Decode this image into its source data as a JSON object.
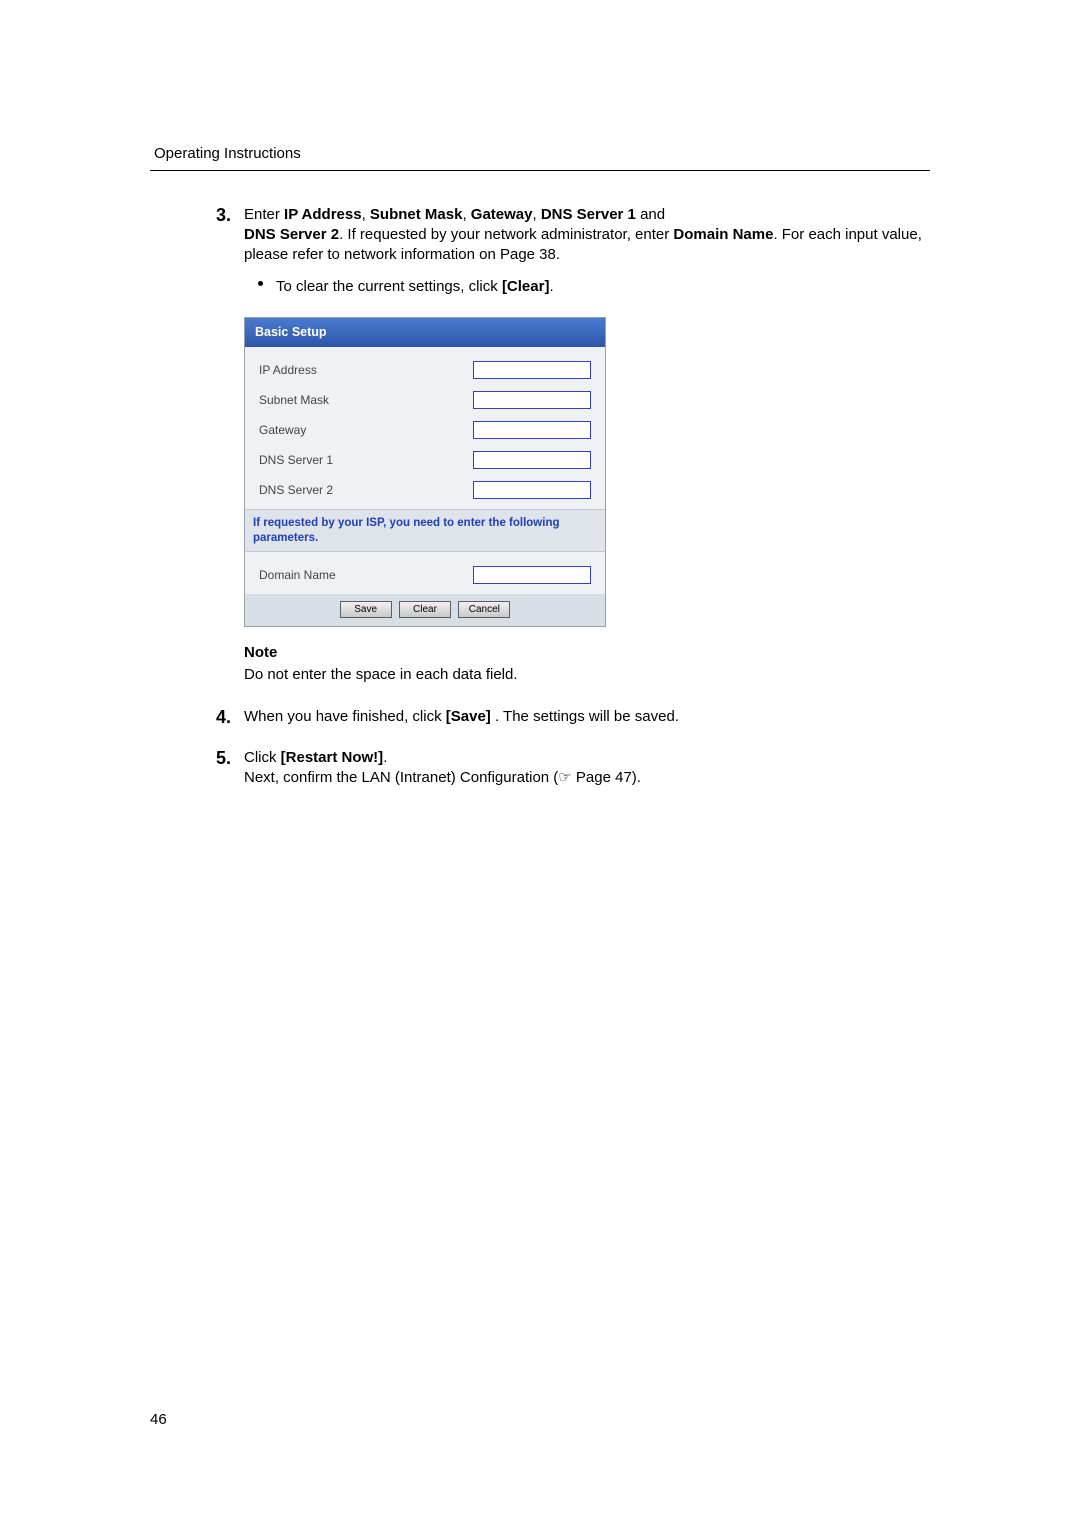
{
  "header": {
    "title": "Operating Instructions"
  },
  "footer": {
    "page_number": "46"
  },
  "steps": {
    "s3": {
      "num": "3.",
      "text_before": "Enter ",
      "b1": "IP Address",
      "c1": ", ",
      "b2": "Subnet Mask",
      "c2": ", ",
      "b3": "Gateway",
      "c3": ", ",
      "b4": "DNS Server 1",
      "c4": " and ",
      "br_b5": "DNS Server 2",
      "after5": ". If requested by your network administrator, enter ",
      "b6": "Domain Name",
      "after6": ". For each input value, please refer to network information on Page 38.",
      "bullet": "To clear the current settings, click ",
      "bullet_b": "[Clear]",
      "bullet_tail": "."
    },
    "note": {
      "heading": "Note",
      "text": "Do not enter the space in each data field."
    },
    "s4": {
      "num": "4.",
      "t1": "When you have finished, click ",
      "b1": "[Save]",
      "t2": ". The settings will be saved."
    },
    "s5": {
      "num": "5.",
      "t1": "Click ",
      "b1": "[Restart Now!]",
      "t2": ".",
      "line2a": "Next, confirm the LAN (Intranet) Configuration (",
      "ref_icon": "☞",
      "line2b": " Page 47)."
    }
  },
  "panel": {
    "header": "Basic Setup",
    "rows": {
      "ip": "IP Address",
      "mask": "Subnet Mask",
      "gw": "Gateway",
      "dns1": "DNS Server 1",
      "dns2": "DNS Server 2",
      "domain": "Domain Name"
    },
    "isp_note": "If requested by your ISP, you need to enter the following parameters.",
    "buttons": {
      "save": "Save",
      "clear": "Clear",
      "cancel": "Cancel"
    }
  }
}
